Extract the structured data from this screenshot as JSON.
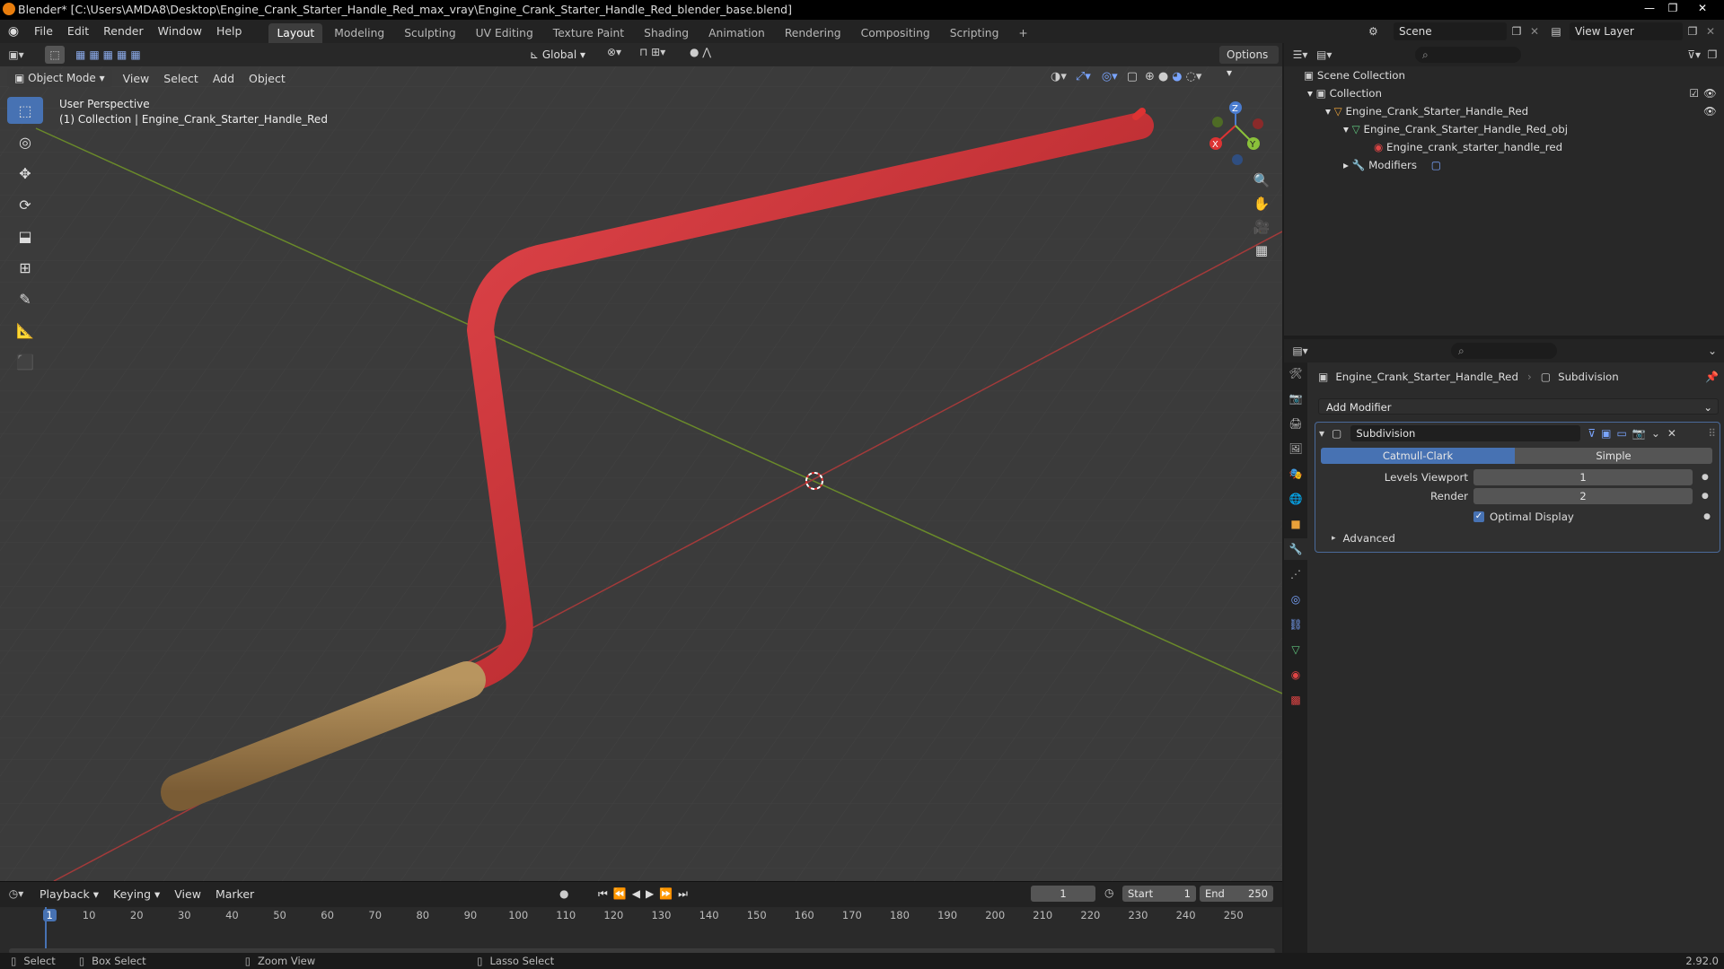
{
  "window": {
    "title": "Blender* [C:\\Users\\AMDA8\\Desktop\\Engine_Crank_Starter_Handle_Red_max_vray\\Engine_Crank_Starter_Handle_Red_blender_base.blend]",
    "minimize": "—",
    "maximize": "❐",
    "close": "✕"
  },
  "menu": {
    "items": [
      "File",
      "Edit",
      "Render",
      "Window",
      "Help"
    ],
    "workspaces": [
      "Layout",
      "Modeling",
      "Sculpting",
      "UV Editing",
      "Texture Paint",
      "Shading",
      "Animation",
      "Rendering",
      "Compositing",
      "Scripting"
    ],
    "add_workspace": "+",
    "scene_label": "Scene",
    "view_layer_label": "View Layer"
  },
  "viewport": {
    "mode": "Object Mode",
    "menus": [
      "View",
      "Select",
      "Add",
      "Object"
    ],
    "transform_orientation": "Global",
    "options": "Options",
    "perspective_label": "User Perspective",
    "collection_label": "(1) Collection | Engine_Crank_Starter_Handle_Red",
    "gizmo": {
      "x": "X",
      "y": "Y",
      "z": "Z"
    },
    "colors": {
      "handle_red": "#cc2a2e",
      "wood": "#9a7a4c",
      "x_axis": "#a33a3a",
      "y_axis": "#6a8a2a"
    }
  },
  "outliner": {
    "scene_collection": "Scene Collection",
    "collection": "Collection",
    "object": "Engine_Crank_Starter_Handle_Red",
    "mesh": "Engine_Crank_Starter_Handle_Red_obj",
    "material": "Engine_crank_starter_handle_red",
    "modifiers": "Modifiers"
  },
  "properties": {
    "breadcrumb_object": "Engine_Crank_Starter_Handle_Red",
    "breadcrumb_modifier": "Subdivision",
    "add_modifier": "Add Modifier",
    "modifier_name": "Subdivision",
    "mode_catmull": "Catmull-Clark",
    "mode_simple": "Simple",
    "levels_viewport_label": "Levels Viewport",
    "levels_viewport_value": "1",
    "render_label": "Render",
    "render_value": "2",
    "optimal_display_label": "Optimal Display",
    "optimal_display_checked": true,
    "advanced_label": "Advanced"
  },
  "timeline": {
    "menus": [
      "Playback",
      "Keying",
      "View",
      "Marker"
    ],
    "current_frame": "1",
    "start_label": "Start",
    "start_value": "1",
    "end_label": "End",
    "end_value": "250",
    "ticks": [
      "1",
      "10",
      "20",
      "30",
      "40",
      "50",
      "60",
      "70",
      "80",
      "90",
      "100",
      "110",
      "120",
      "130",
      "140",
      "150",
      "160",
      "170",
      "180",
      "190",
      "200",
      "210",
      "220",
      "230",
      "240",
      "250"
    ]
  },
  "status": {
    "select": "Select",
    "box_select": "Box Select",
    "zoom_view": "Zoom View",
    "lasso_select": "Lasso Select",
    "version": "2.92.0"
  }
}
